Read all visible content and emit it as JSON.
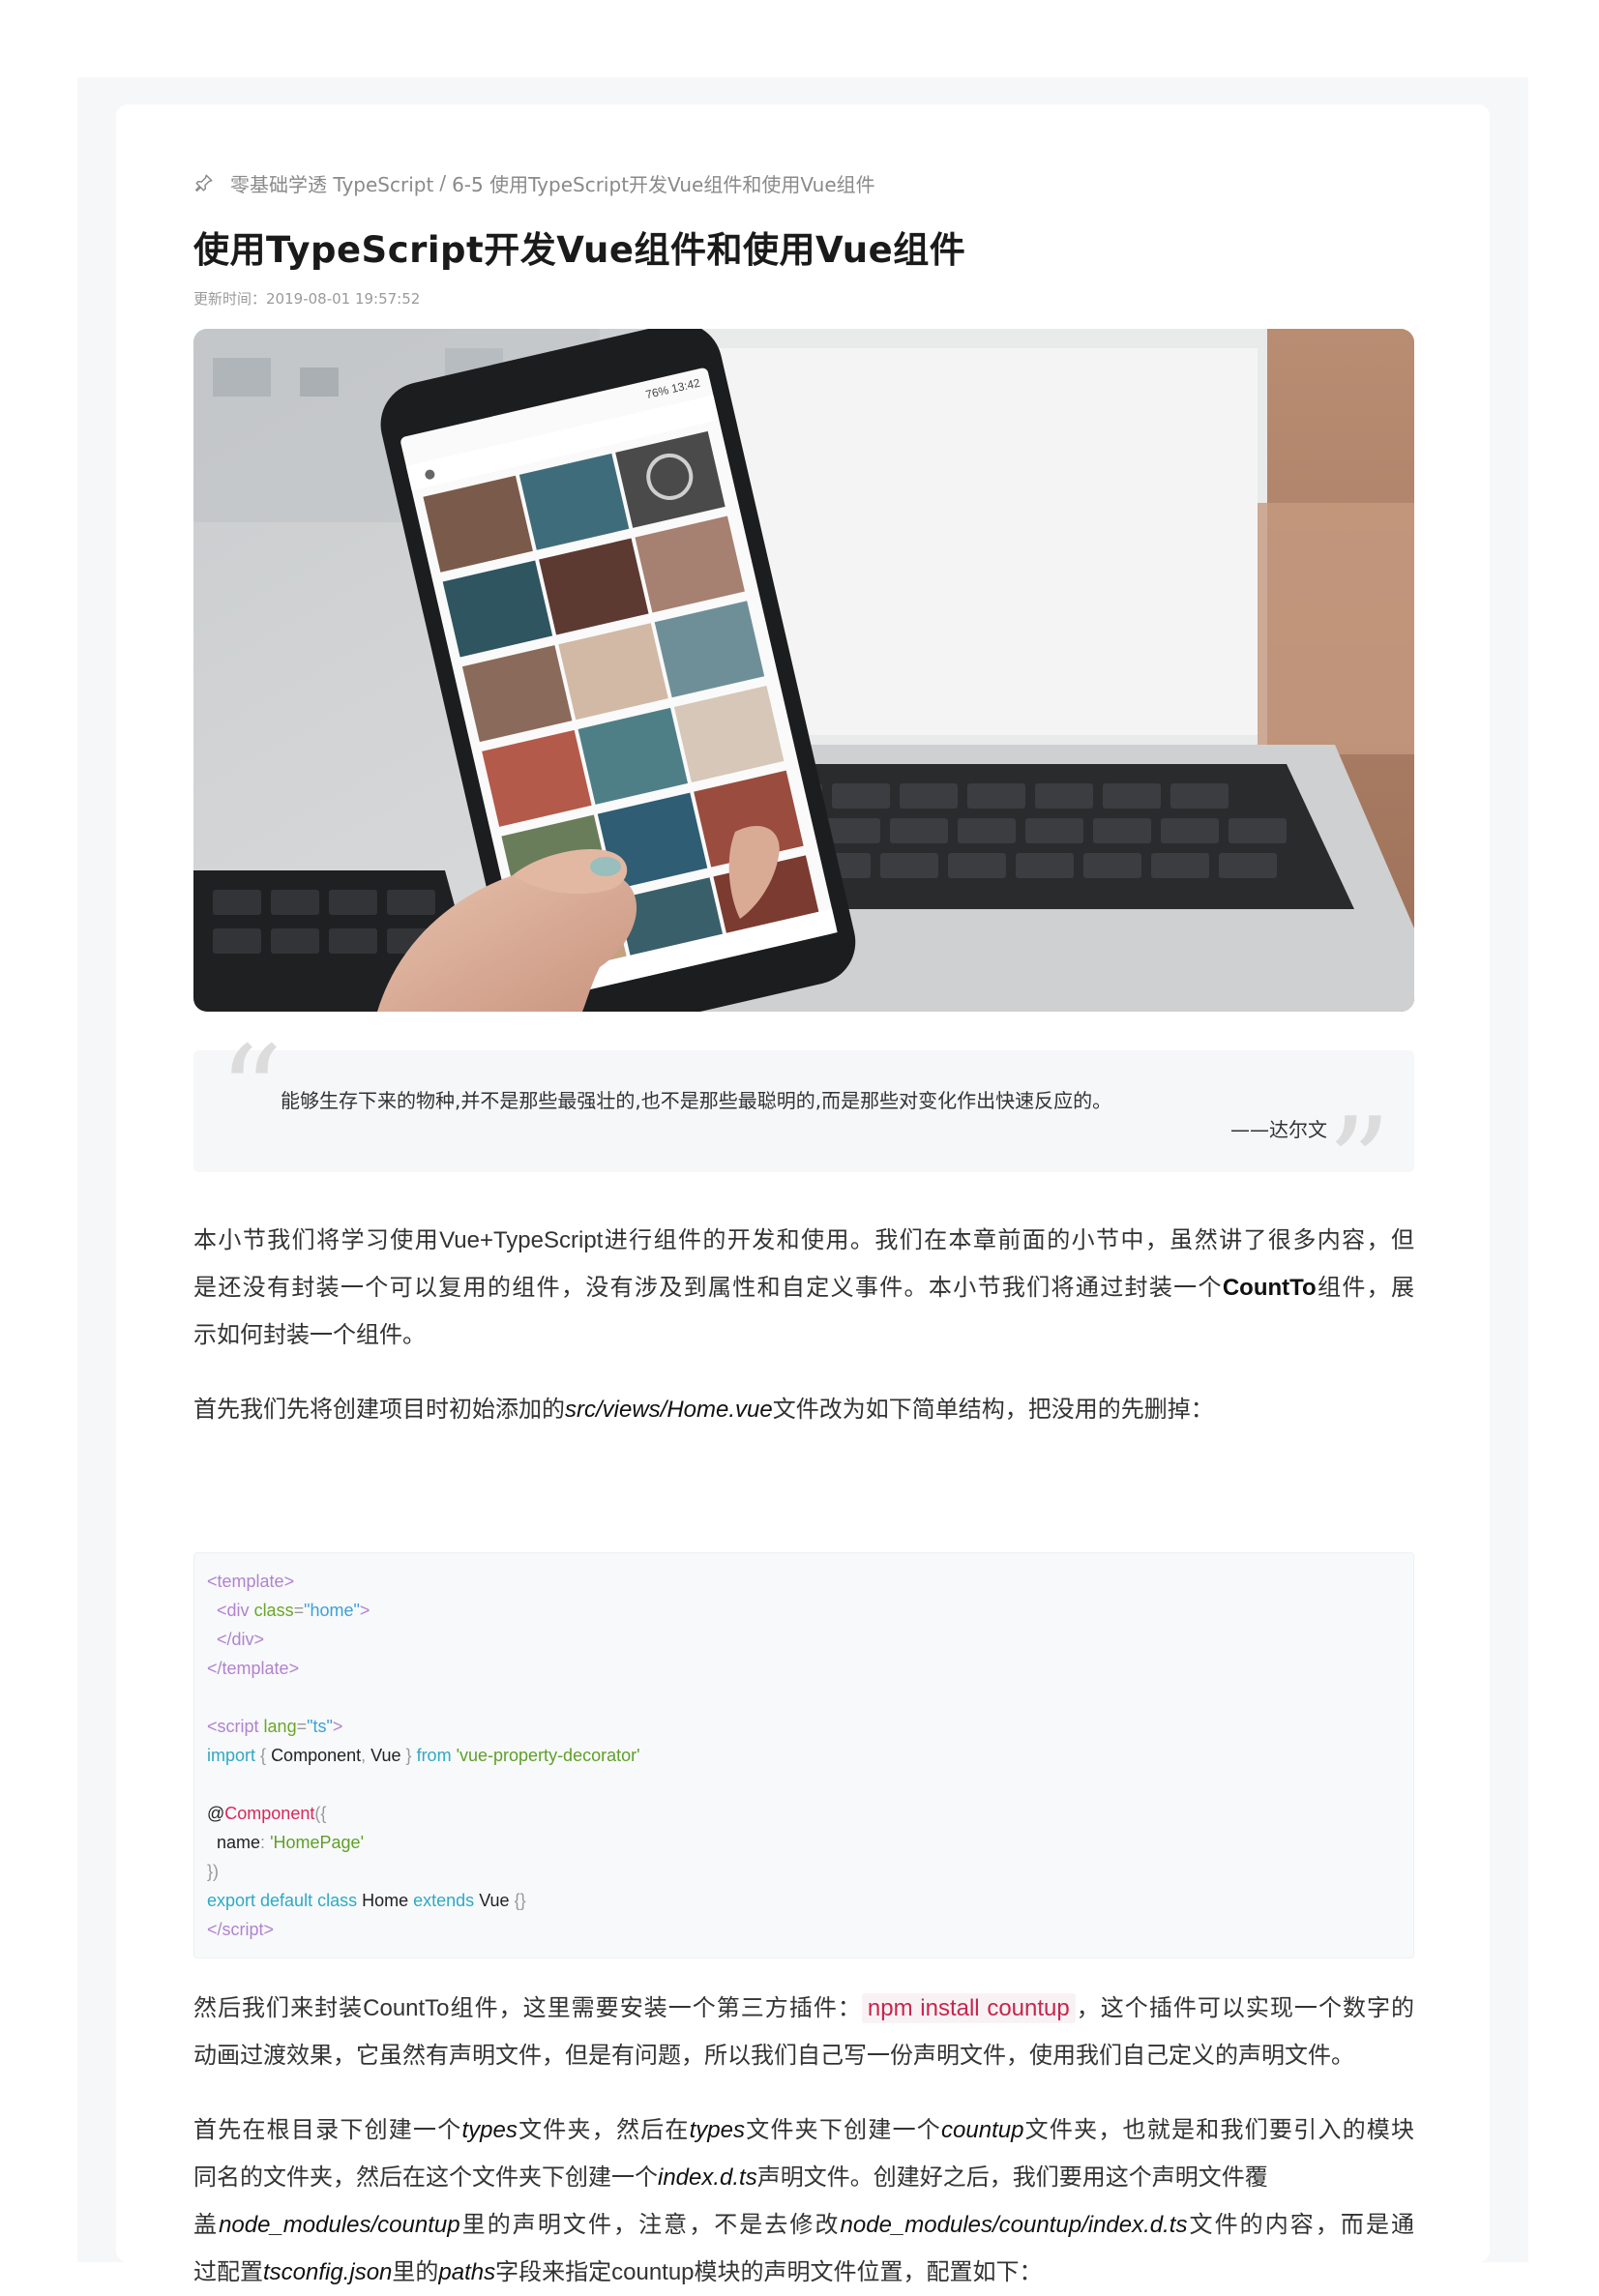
{
  "breadcrumb": {
    "course": "零基础学透 TypeScript",
    "separator": "/",
    "chapter": "6-5 使用TypeScript开发Vue组件和使用Vue组件"
  },
  "title": "使用TypeScript开发Vue组件和使用Vue组件",
  "meta": {
    "label": "更新时间：",
    "time": "2019-08-01 19:57:52"
  },
  "hero_image": {
    "description": "hand holding a smartphone showing a photo grid app in front of a laptop",
    "phone_status": "76% 13:42"
  },
  "quote": {
    "text": "能够生存下来的物种,并不是那些最强壮的,也不是那些最聪明的,而是那些对变化作出快速反应的。",
    "author": "——达尔文"
  },
  "p1": {
    "l1a": "本小节我们将学习使用",
    "l1b": "Vue+TypeScript",
    "l1c": "进行组件的开发和使用。我们在本章前面的小节中，虽然讲了很多内容，但",
    "l2a": "是还没有封装一个可以复用的组件，没有涉及到属性和自定义事件。本小节我们将通过封装一个",
    "l2b": "CountTo",
    "l2c": "组件，展",
    "l3": "示如何封装一个组件。"
  },
  "p2": {
    "a": "首先我们先将创建项目时初始添加的",
    "path": "src/views/Home.vue",
    "b": "文件改为如下简单结构，把没用的先删掉："
  },
  "code": {
    "template_open": "template",
    "div": "div",
    "class_attr": "class",
    "class_val": "\"home\"",
    "template_close": "template",
    "script": "script",
    "lang_attr": "lang",
    "lang_val": "\"ts\"",
    "import_kw": "import",
    "component_name": "Component",
    "vue_name": "Vue",
    "from_kw": "from",
    "module_str": "'vue-property-decorator'",
    "decorator": "Component",
    "name_key": "name",
    "name_val": "'HomePage'",
    "export_kw": "export default class",
    "class_name": "Home",
    "extends_kw": "extends",
    "extends_name": "Vue"
  },
  "p3": {
    "a": "然后我们来封装",
    "name": "CountTo",
    "b": "组件，这里需要安装一个第三方插件：",
    "cmd": "npm install countup",
    "c": "，这个插件可以实现一个数字的",
    "l2": "动画过渡效果，它虽然有声明文件，但是有问题，所以我们自己写一份声明文件，使用我们自己定义的声明文件。"
  },
  "p4": {
    "l1a": "首先在根目录下创建一个",
    "l1b": "types",
    "l1c": "文件夹，然后在",
    "l1d": "types",
    "l1e": "文件夹下创建一个",
    "l1f": "countup",
    "l1g": "文件夹，也就是和我们要引入的模块",
    "l2a": "同名的文件夹，然后在这个文件夹下创建一个",
    "l2b": "index.d.ts",
    "l2c": "声明文件。创建好之后，我们要用这个声明文件覆",
    "l3a": "盖",
    "l3b": "node_modules/countup",
    "l3c": "里的声明文件，注意，不是去修改",
    "l3d": "node_modules/countup/index.d.ts",
    "l3e": "文件的内容，而是通",
    "l4a": "过配置",
    "l4b": "tsconfig.json",
    "l4c": "里的",
    "l4d": "paths",
    "l4e": "字段来指定",
    "l4f": "countup",
    "l4g": "模块的声明文件位置，配置如下："
  }
}
